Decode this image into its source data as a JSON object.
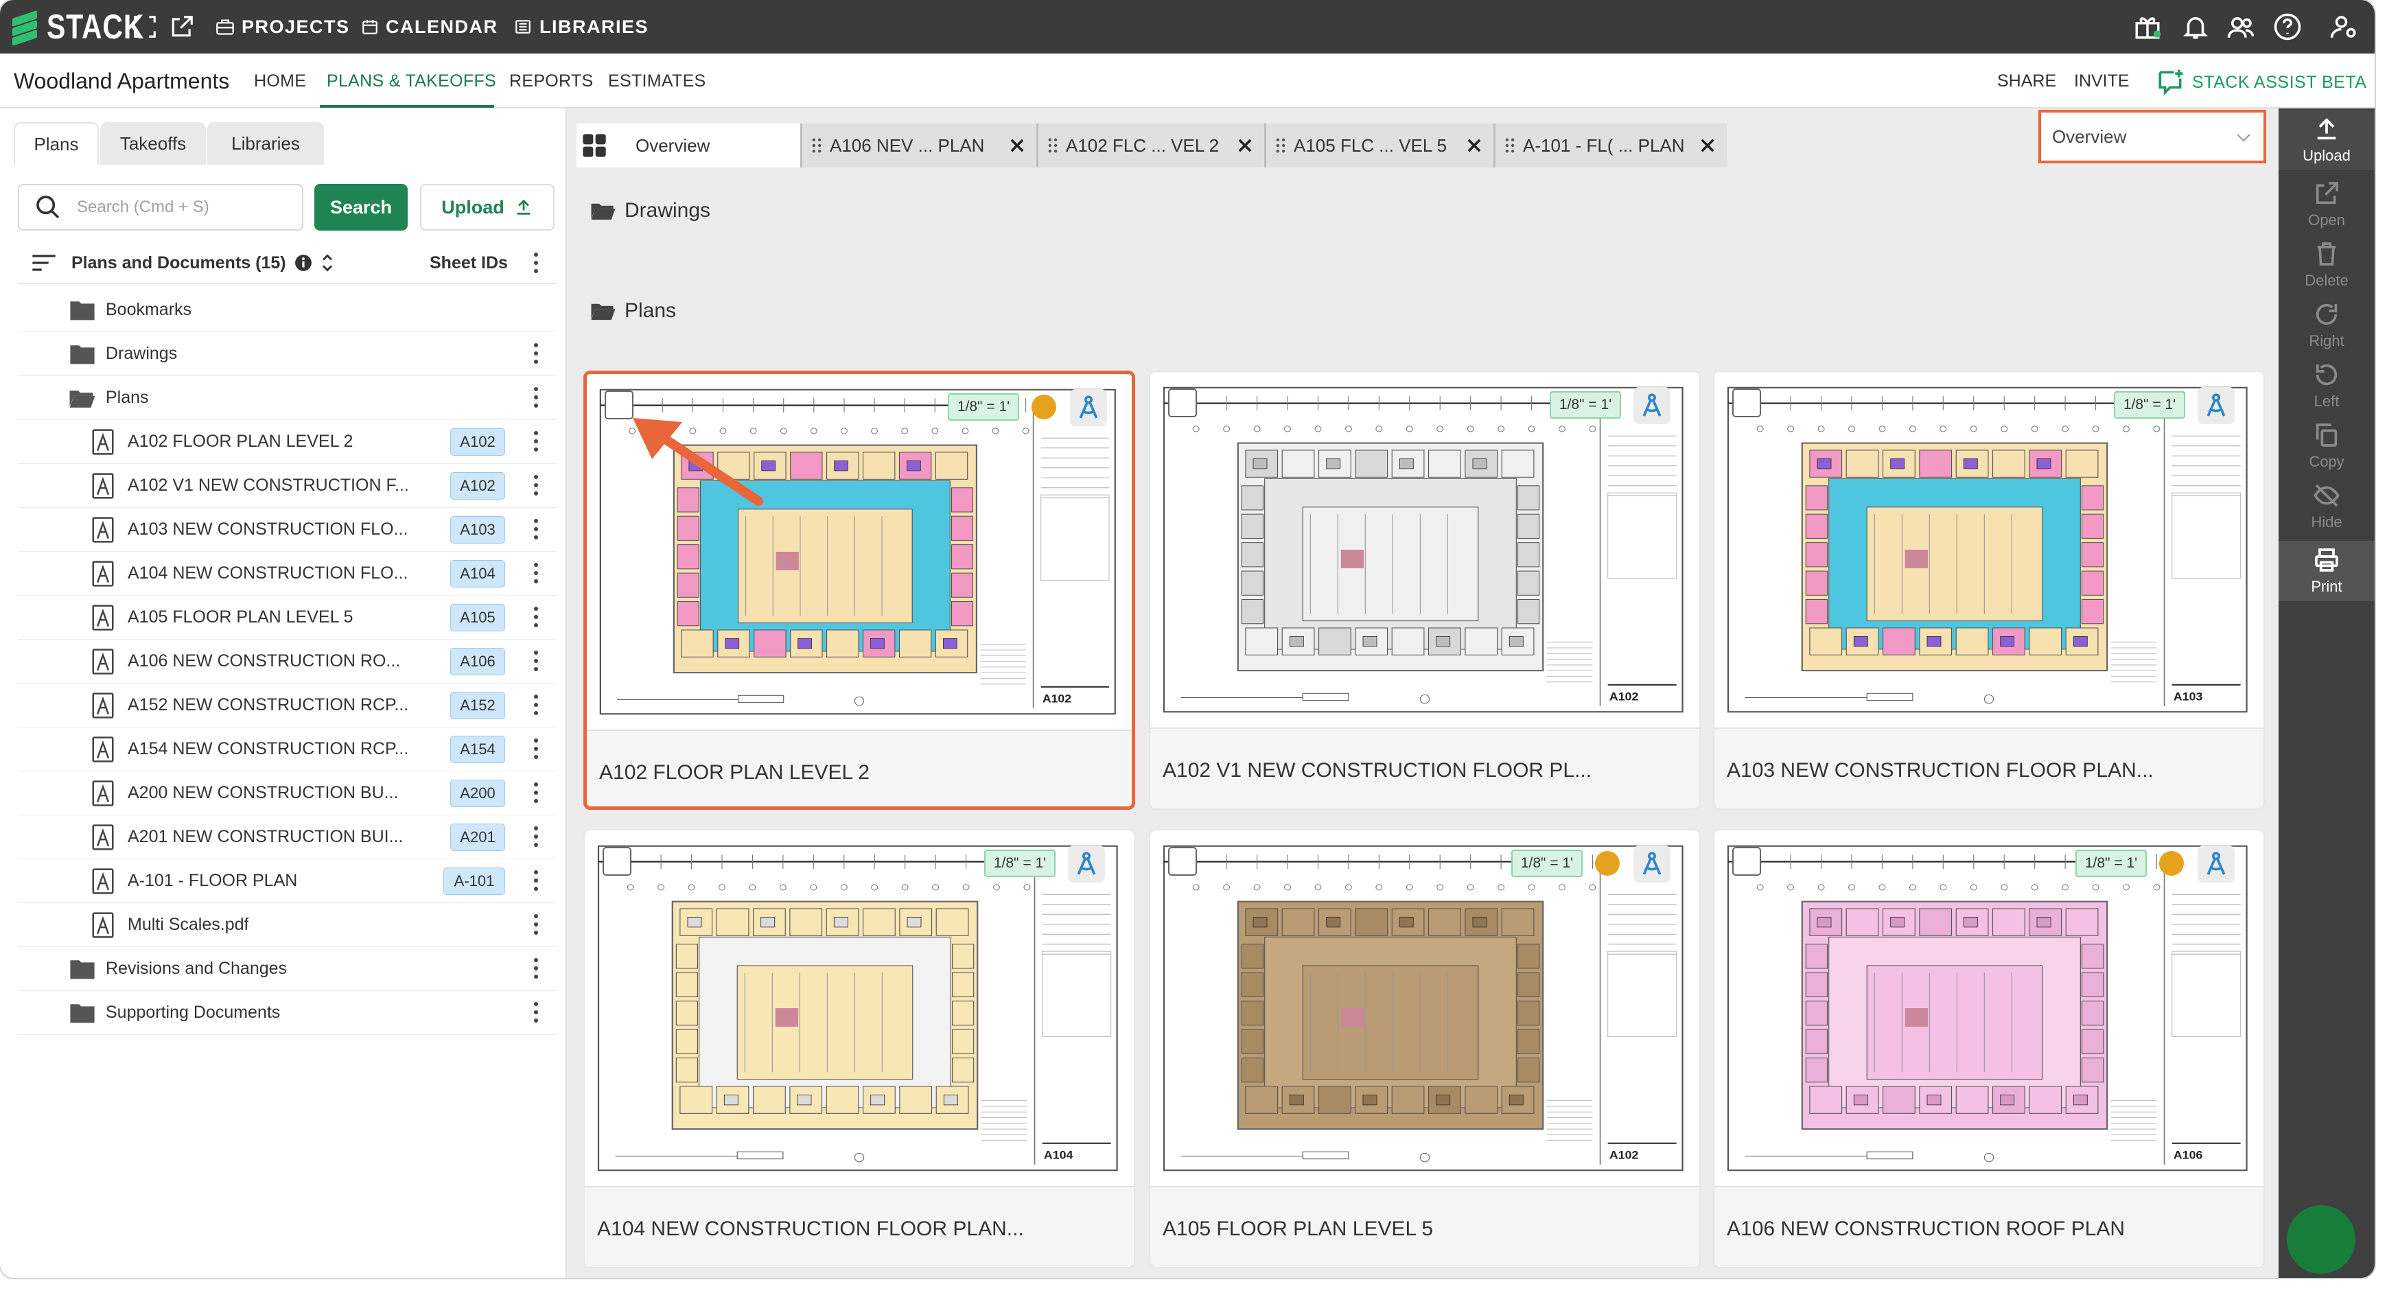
{
  "brand": {
    "name": "STACK"
  },
  "topnav": [
    {
      "label": "PROJECTS",
      "icon": "briefcase-icon"
    },
    {
      "label": "CALENDAR",
      "icon": "calendar-icon"
    },
    {
      "label": "LIBRARIES",
      "icon": "library-icon"
    }
  ],
  "project": {
    "title": "Woodland Apartments",
    "nav": [
      "HOME",
      "PLANS & TAKEOFFS",
      "REPORTS",
      "ESTIMATES"
    ],
    "active_nav": "PLANS & TAKEOFFS",
    "right": [
      "SHARE",
      "INVITE"
    ],
    "assist": "STACK ASSIST BETA"
  },
  "left_tabs": [
    "Plans",
    "Takeoffs",
    "Libraries"
  ],
  "search": {
    "placeholder": "Search (Cmd + S)",
    "button": "Search",
    "upload": "Upload"
  },
  "tree": {
    "header": "Plans and Documents (15)",
    "sheet_ids": "Sheet IDs",
    "folders_top": [
      "Bookmarks",
      "Drawings",
      "Plans"
    ],
    "plans": [
      {
        "name": "A102 FLOOR PLAN LEVEL 2",
        "id": "A102"
      },
      {
        "name": "A102 V1 NEW CONSTRUCTION F...",
        "id": "A102"
      },
      {
        "name": "A103 NEW CONSTRUCTION FLO...",
        "id": "A103"
      },
      {
        "name": "A104 NEW CONSTRUCTION FLO...",
        "id": "A104"
      },
      {
        "name": "A105 FLOOR PLAN LEVEL 5",
        "id": "A105"
      },
      {
        "name": "A106 NEW CONSTRUCTION RO...",
        "id": "A106"
      },
      {
        "name": "A152 NEW CONSTRUCTION RCP...",
        "id": "A152"
      },
      {
        "name": "A154 NEW CONSTRUCTION RCP...",
        "id": "A154"
      },
      {
        "name": "A200 NEW CONSTRUCTION BU...",
        "id": "A200"
      },
      {
        "name": "A201 NEW CONSTRUCTION BUI...",
        "id": "A201"
      },
      {
        "name": "A-101 - FLOOR PLAN",
        "id": "A-101"
      },
      {
        "name": "Multi Scales.pdf",
        "id": ""
      }
    ],
    "folders_bottom": [
      "Revisions and Changes",
      "Supporting Documents"
    ]
  },
  "tabs": {
    "overview": "Overview",
    "docs": [
      "A106 NEV ... PLAN",
      "A102 FLC ... VEL 2",
      "A105 FLC ... VEL 5",
      "A-101 - FL( ... PLAN"
    ],
    "select": "Overview"
  },
  "sections": {
    "drawings": "Drawings",
    "plans": "Plans"
  },
  "cards": [
    {
      "title": "A102 FLOOR PLAN LEVEL 2",
      "scale": "1/8\" = 1'",
      "sheet": "A102",
      "dot": true,
      "highlight": true,
      "palette": "color"
    },
    {
      "title": "A102 V1 NEW CONSTRUCTION FLOOR PL...",
      "scale": "1/8\" = 1'",
      "sheet": "A102",
      "dot": false,
      "highlight": false,
      "palette": "gray"
    },
    {
      "title": "A103 NEW CONSTRUCTION FLOOR PLAN...",
      "scale": "1/8\" = 1'",
      "sheet": "A103",
      "dot": false,
      "highlight": false,
      "palette": "color"
    },
    {
      "title": "A104 NEW CONSTRUCTION FLOOR PLAN...",
      "scale": "1/8\" = 1'",
      "sheet": "A104",
      "dot": false,
      "highlight": false,
      "palette": "yellow"
    },
    {
      "title": "A105 FLOOR PLAN LEVEL 5",
      "scale": "1/8\" = 1'",
      "sheet": "A102",
      "dot": true,
      "highlight": false,
      "palette": "brown"
    },
    {
      "title": "A106 NEW CONSTRUCTION ROOF PLAN",
      "scale": "1/8\" = 1'",
      "sheet": "A106",
      "dot": true,
      "highlight": false,
      "palette": "pink"
    }
  ],
  "rail": [
    {
      "label": "Upload",
      "icon": "upload-icon",
      "enabled": true
    },
    {
      "label": "Open",
      "icon": "open-icon",
      "enabled": false
    },
    {
      "label": "Delete",
      "icon": "trash-icon",
      "enabled": false
    },
    {
      "label": "Right",
      "icon": "rotate-right-icon",
      "enabled": false
    },
    {
      "label": "Left",
      "icon": "rotate-left-icon",
      "enabled": false
    },
    {
      "label": "Copy",
      "icon": "copy-icon",
      "enabled": false
    },
    {
      "label": "Hide",
      "icon": "hide-icon",
      "enabled": false
    },
    {
      "label": "Print",
      "icon": "print-icon",
      "enabled": true
    }
  ],
  "colors": {
    "accent": "#1f8552",
    "highlight": "#e8663a",
    "badge": "#cfe7fa"
  }
}
